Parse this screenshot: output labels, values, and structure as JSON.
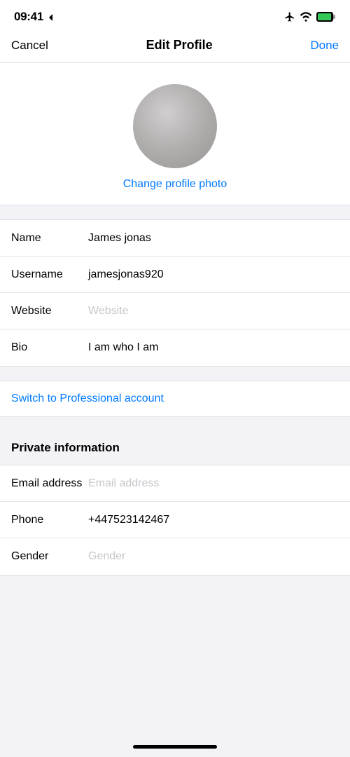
{
  "statusBar": {
    "time": "09:41",
    "timeArrow": "◂"
  },
  "navBar": {
    "cancelLabel": "Cancel",
    "title": "Edit Profile",
    "doneLabel": "Done"
  },
  "photoSection": {
    "changePhotoLabel": "Change profile photo"
  },
  "formFields": [
    {
      "label": "Name",
      "value": "James jonas",
      "placeholder": false
    },
    {
      "label": "Username",
      "value": "jamesjonas920",
      "placeholder": false
    },
    {
      "label": "Website",
      "value": "Website",
      "placeholder": true
    },
    {
      "label": "Bio",
      "value": "I am who I am",
      "placeholder": false
    }
  ],
  "switchProfessional": {
    "label": "Switch to Professional account"
  },
  "privateInfo": {
    "title": "Private information",
    "fields": [
      {
        "label": "Email address",
        "value": "Email address",
        "placeholder": true
      },
      {
        "label": "Phone",
        "value": "+447523142467",
        "placeholder": false
      },
      {
        "label": "Gender",
        "value": "Gender",
        "placeholder": true
      }
    ]
  }
}
